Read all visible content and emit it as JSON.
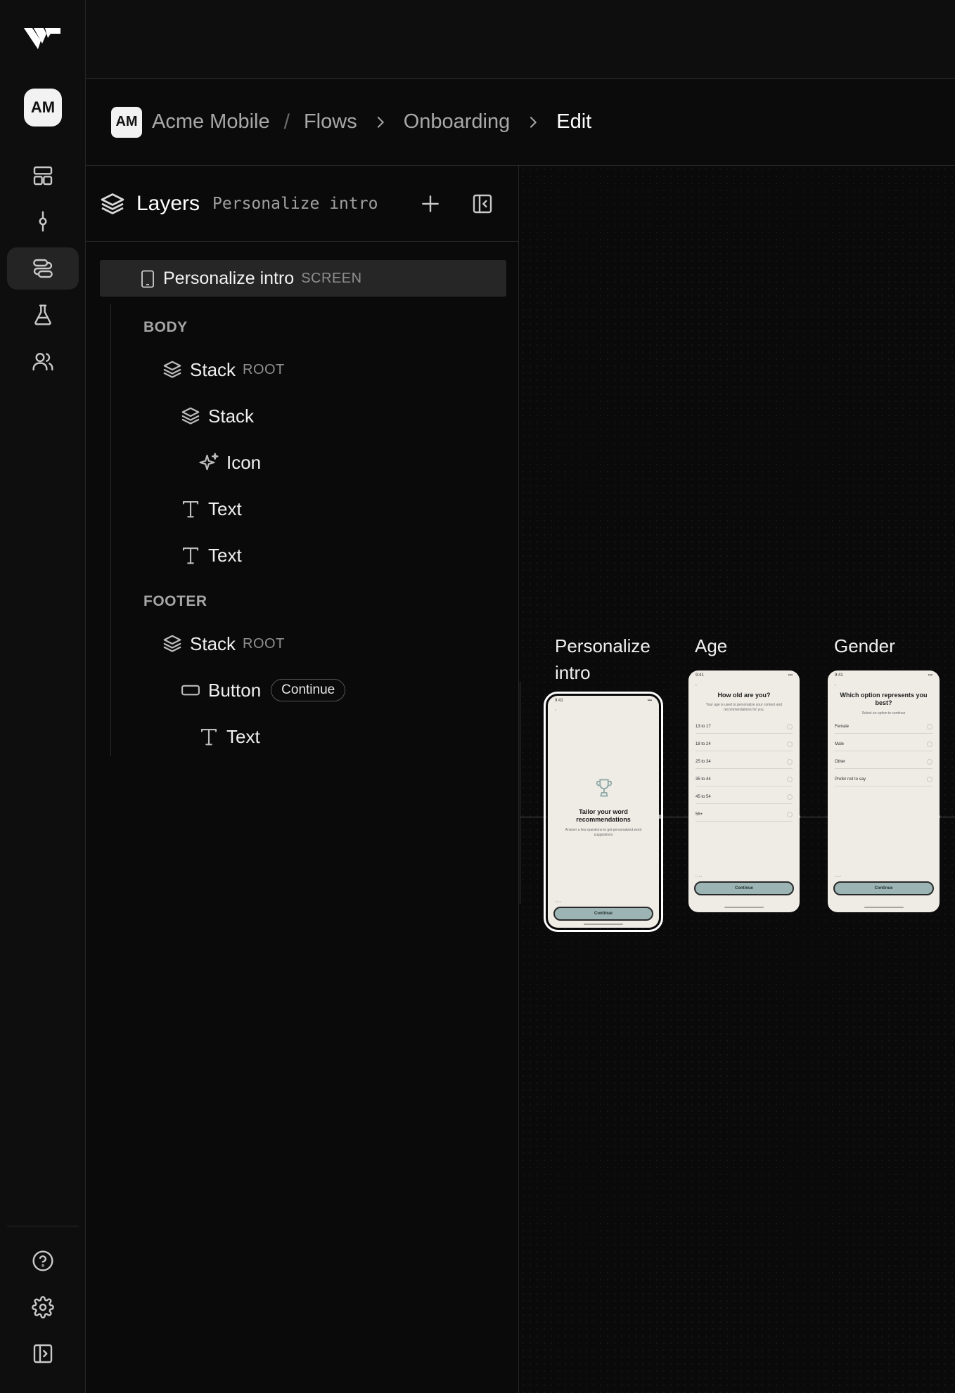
{
  "app": {
    "brand_icon": "app-logo",
    "workspace_avatar": "AM"
  },
  "rail": {
    "items": [
      {
        "name": "dashboard-icon",
        "active": false
      },
      {
        "name": "commit-icon",
        "active": false
      },
      {
        "name": "flows-icon",
        "active": true
      },
      {
        "name": "experiments-flask-icon",
        "active": false
      },
      {
        "name": "users-icon",
        "active": false
      }
    ],
    "bottom": [
      {
        "name": "help-icon"
      },
      {
        "name": "settings-gear-icon"
      },
      {
        "name": "expand-sidebar-icon"
      }
    ]
  },
  "breadcrumb": {
    "avatar": "AM",
    "project": "Acme Mobile",
    "separator": "/",
    "section": "Flows",
    "flow": "Onboarding",
    "current": "Edit"
  },
  "layers": {
    "title": "Layers",
    "subtitle": "Personalize intro",
    "screen": {
      "label": "Personalize intro",
      "tag": "SCREEN"
    },
    "sections": {
      "body": "BODY",
      "footer": "FOOTER"
    },
    "body_nodes": [
      {
        "label": "Stack",
        "tag": "ROOT",
        "icon": "stack-icon"
      },
      {
        "label": "Stack",
        "tag": "",
        "icon": "stack-icon"
      },
      {
        "label": "Icon",
        "tag": "",
        "icon": "sparkle-icon"
      },
      {
        "label": "Text",
        "tag": "",
        "icon": "text-icon"
      },
      {
        "label": "Text",
        "tag": "",
        "icon": "text-icon"
      }
    ],
    "footer_nodes": [
      {
        "label": "Stack",
        "tag": "ROOT",
        "icon": "stack-icon"
      },
      {
        "label": "Button",
        "pill": "Continue",
        "icon": "button-icon"
      },
      {
        "label": "Text",
        "tag": "",
        "icon": "text-icon"
      }
    ]
  },
  "canvas": {
    "screens": [
      {
        "title": "Personalize intro",
        "selected": true,
        "status_time": "9:41",
        "heading": "Tailor your word recommendations",
        "sub": "Answer a few questions to get personalized word suggestions",
        "cta": "Continue"
      },
      {
        "title": "Age",
        "selected": false,
        "status_time": "9:41",
        "heading": "How old are you?",
        "sub": "Your age is used to personalize your content and recommendations for you.",
        "options": [
          "13 to 17",
          "18 to 24",
          "25 to 34",
          "35 to 44",
          "45 to 54",
          "55+"
        ],
        "cta": "Continue"
      },
      {
        "title": "Gender",
        "selected": false,
        "status_time": "9:41",
        "heading": "Which option represents you best?",
        "sub": "Select an option to continue",
        "options": [
          "Female",
          "Male",
          "Other",
          "Prefer not to say"
        ],
        "cta": "Continue"
      }
    ]
  },
  "colors": {
    "background": "#0a0a0a",
    "panel_border": "#262626",
    "phone_bg": "#efece6",
    "cta_teal": "#9cb5b4"
  }
}
